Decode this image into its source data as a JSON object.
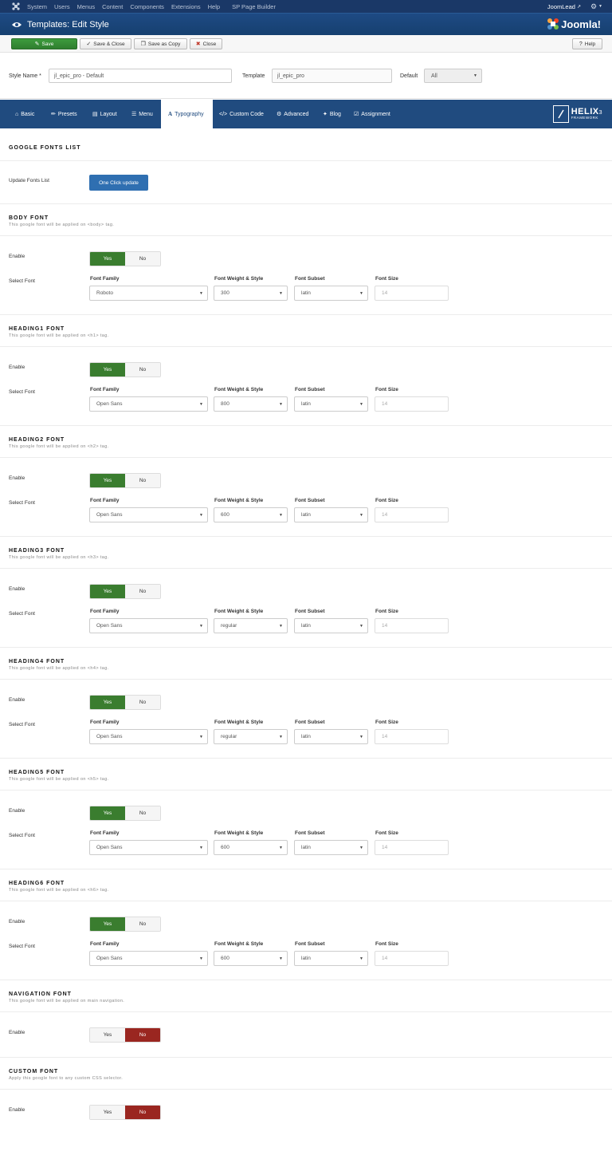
{
  "topbar": {
    "menu": [
      "System",
      "Users",
      "Menus",
      "Content",
      "Components",
      "Extensions",
      "Help",
      "SP Page Builder"
    ],
    "site_link": "JoomLead"
  },
  "titlebar": {
    "title": "Templates: Edit Style",
    "brand": "Joomla!"
  },
  "toolbar": {
    "save": "Save",
    "save_close": "Save & Close",
    "save_copy": "Save as Copy",
    "close": "Close",
    "help": "Help"
  },
  "style": {
    "name_label": "Style Name *",
    "name_value": "jl_epic_pro - Default",
    "template_label": "Template",
    "template_value": "jl_epic_pro",
    "default_label": "Default",
    "default_value": "All"
  },
  "tabs": [
    "Basic",
    "Presets",
    "Layout",
    "Menu",
    "Typography",
    "Custom Code",
    "Advanced",
    "Blog",
    "Assignment"
  ],
  "helix": {
    "name": "HELIX",
    "version": "3",
    "sub": "FRAMEWORK"
  },
  "google_fonts": {
    "title": "GOOGLE FONTS LIST",
    "update_label": "Update Fonts List",
    "update_button": "One Click update"
  },
  "labels": {
    "enable": "Enable",
    "select_font": "Select Font",
    "font_family": "Font Family",
    "font_weight": "Font Weight & Style",
    "font_subset": "Font Subset",
    "font_size": "Font Size",
    "yes": "Yes",
    "no": "No"
  },
  "font_sections": [
    {
      "title": "BODY FONT",
      "desc": "This google font will be applied on <body> tag.",
      "family": "Roboto",
      "weight": "300",
      "subset": "latin",
      "size": "14"
    },
    {
      "title": "HEADING1 FONT",
      "desc": "This google font will be applied on <h1> tag.",
      "family": "Open Sans",
      "weight": "800",
      "subset": "latin",
      "size": "14"
    },
    {
      "title": "HEADING2 FONT",
      "desc": "This google font will be applied on <h2> tag.",
      "family": "Open Sans",
      "weight": "600",
      "subset": "latin",
      "size": "14"
    },
    {
      "title": "HEADING3 FONT",
      "desc": "This google font will be applied on <h3> tag.",
      "family": "Open Sans",
      "weight": "regular",
      "subset": "latin",
      "size": "14"
    },
    {
      "title": "HEADING4 FONT",
      "desc": "This google font will be applied on <h4> tag.",
      "family": "Open Sans",
      "weight": "regular",
      "subset": "latin",
      "size": "14"
    },
    {
      "title": "HEADING5 FONT",
      "desc": "This google font will be applied on <h5> tag.",
      "family": "Open Sans",
      "weight": "600",
      "subset": "latin",
      "size": "14"
    },
    {
      "title": "HEADING6 FONT",
      "desc": "This google font will be applied on <h6> tag.",
      "family": "Open Sans",
      "weight": "600",
      "subset": "latin",
      "size": "14"
    }
  ],
  "navigation_font": {
    "title": "NAVIGATION FONT",
    "desc": "This google font will be applied on main navigation."
  },
  "custom_font": {
    "title": "CUSTOM FONT",
    "desc": "Apply this google font to any custom CSS selector."
  },
  "colors": {
    "topbar": "#1a3867",
    "titlebar": "#1e4a84",
    "tabs": "#204b7f",
    "yes_active": "#3a7d2f",
    "no_active": "#9a2620",
    "update_button": "#2f6fb1"
  }
}
